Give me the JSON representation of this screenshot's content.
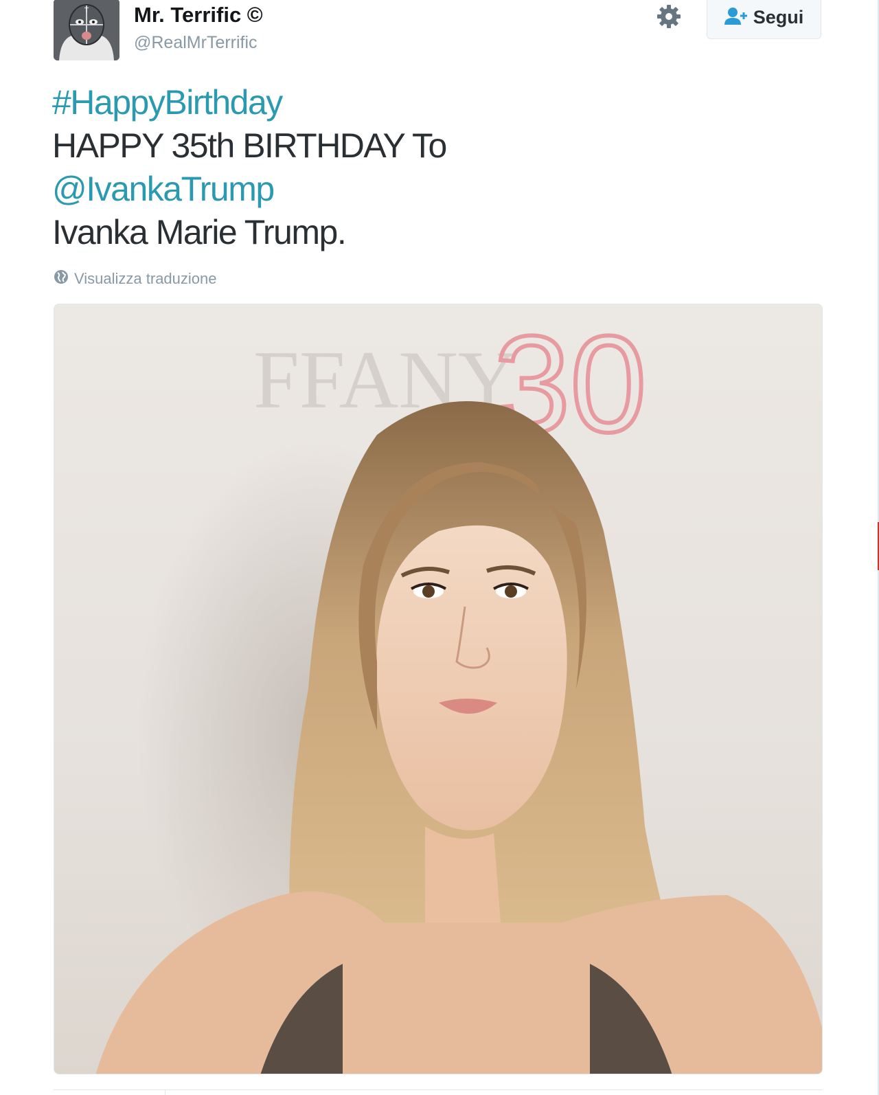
{
  "tweet": {
    "author": {
      "name": "Mr. Terrific ©",
      "handle": "@RealMrTerrific",
      "avatar": "masked-wrestler-avatar"
    },
    "actions": {
      "settings_icon": "gear-icon",
      "follow_icon": "add-user-icon",
      "follow_label": "Segui"
    },
    "text": {
      "hashtag": "#HappyBirthday",
      "line2": "HAPPY 35th BIRTHDAY To",
      "mention": "@IvankaTrump",
      "line4": "Ivanka Marie Trump."
    },
    "translate": {
      "icon": "globe-icon",
      "label": "Visualizza traduzione"
    },
    "media": {
      "backdrop_text": "FFANY",
      "backdrop_number": "30"
    }
  },
  "colors": {
    "link": "#2b9ab0",
    "text": "#292f33",
    "muted": "#8899a6",
    "border": "#e1e8ed"
  }
}
